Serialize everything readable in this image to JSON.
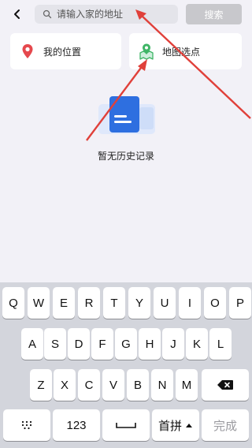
{
  "header": {
    "back_icon": "chevron-left-icon",
    "search_placeholder": "请输入家的地址",
    "search_value": "",
    "search_button_label": "搜索",
    "search_button_color": "#c8c8cc"
  },
  "options": {
    "my_location": {
      "label": "我的位置",
      "icon": "location-pin-icon",
      "icon_color": "#e5484d"
    },
    "map_pick": {
      "label": "地图选点",
      "icon": "map-pin-icon",
      "icon_color": "#3fb566"
    }
  },
  "empty_state": {
    "text": "暂无历史记录",
    "icon": "document-icon",
    "icon_color": "#2e6fe0"
  },
  "keyboard": {
    "row1": [
      "Q",
      "W",
      "E",
      "R",
      "T",
      "Y",
      "U",
      "I",
      "O",
      "P"
    ],
    "row2": [
      "A",
      "S",
      "D",
      "F",
      "G",
      "H",
      "J",
      "K",
      "L"
    ],
    "row3": [
      "Z",
      "X",
      "C",
      "V",
      "B",
      "N",
      "M"
    ],
    "num_key": "123",
    "lang_key": "首拼",
    "done_key": "完成",
    "emoji_key_icon": "keypad-icon",
    "space_key_icon": "space-icon",
    "backspace_key_icon": "backspace-icon",
    "lang_arrow_icon": "caret-up-icon"
  },
  "annotation_color": "#e0403a"
}
